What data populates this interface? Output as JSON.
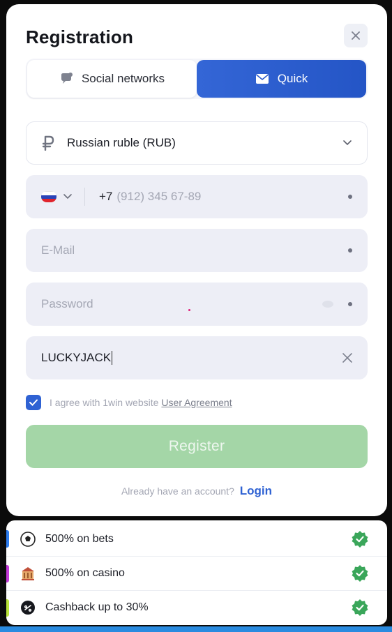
{
  "modal": {
    "title": "Registration"
  },
  "tabs": {
    "social_label": "Social networks",
    "quick_label": "Quick",
    "active": "Quick"
  },
  "form": {
    "currency_value": "Russian ruble (RUB)",
    "phone_code": "+7",
    "phone_placeholder": "(912) 345 67-89",
    "email_placeholder": "E-Mail",
    "password_placeholder": "Password",
    "promo_value": "LUCKYJACK",
    "agree_text": "I agree with 1win website",
    "agree_link": "User Agreement",
    "agree_checked": true,
    "register_label": "Register",
    "login_prompt": "Already have an account?",
    "login_link": "Login"
  },
  "bonuses": [
    {
      "label": "500% on bets",
      "icon": "soccer-ball-icon",
      "stripe": "#2d7df0"
    },
    {
      "label": "500% on casino",
      "icon": "casino-icon",
      "stripe": "#c23ad8"
    },
    {
      "label": "Cashback up to 30%",
      "icon": "cashback-icon",
      "stripe": "#b9e33a"
    }
  ],
  "colors": {
    "accent": "#2f62d3",
    "register_disabled": "#a4d6a7",
    "check_green": "#3aa65a"
  }
}
